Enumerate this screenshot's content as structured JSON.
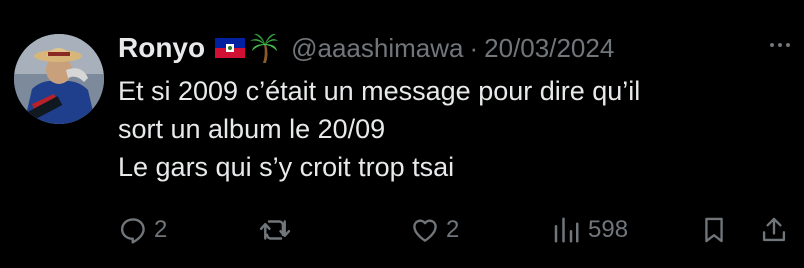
{
  "tweet": {
    "author_name": "Ronyo",
    "handle": "@aaashimawa",
    "separator": "·",
    "date": "20/03/2024",
    "flag_icon": "haiti-flag-icon",
    "emoji_icon": "palm-tree-icon",
    "text_lines": [
      "Et si 2009 c’était un message pour dire qu’il",
      "sort un album le 20/09",
      "Le gars qui s’y croit trop tsai"
    ]
  },
  "actions": {
    "reply_count": "2",
    "retweet_count": "",
    "like_count": "2",
    "views_count": "598"
  },
  "colors": {
    "background": "#000000",
    "text_primary": "#e7e9ea",
    "text_secondary": "#71767b"
  }
}
